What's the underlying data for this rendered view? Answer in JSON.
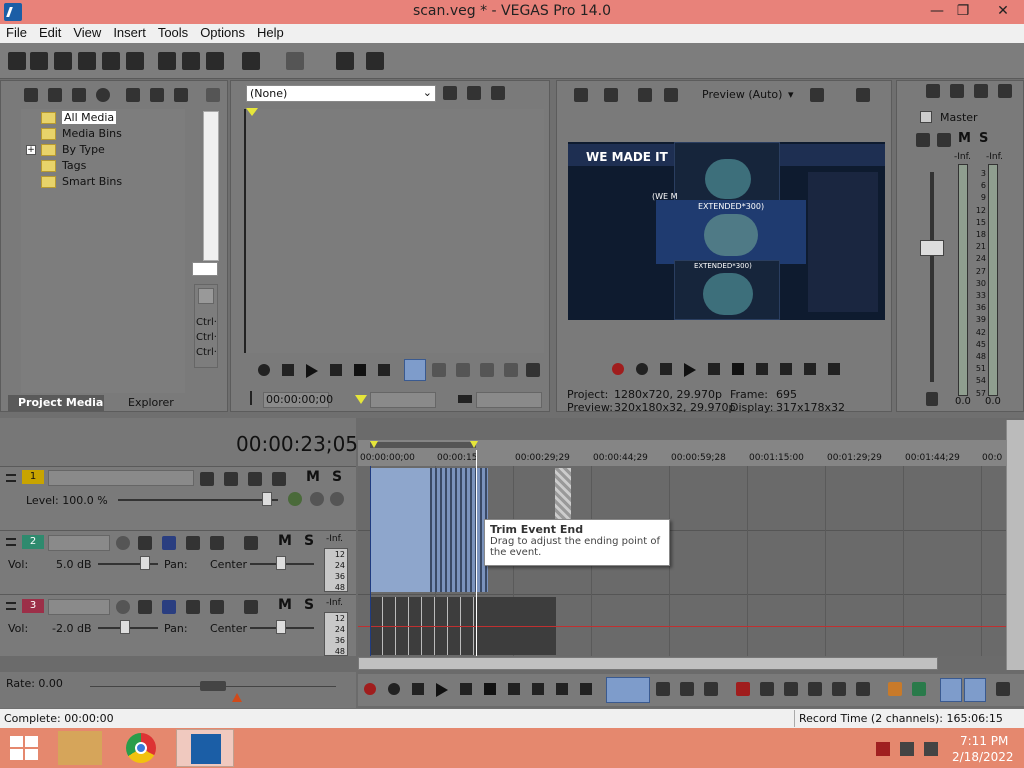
{
  "window": {
    "title": "scan.veg * - VEGAS Pro 14.0",
    "minimize": "—",
    "restore": "❐",
    "close": "✕"
  },
  "menu": [
    "File",
    "Edit",
    "View",
    "Insert",
    "Tools",
    "Options",
    "Help"
  ],
  "project_media": {
    "tree": [
      "All Media",
      "Media Bins",
      "By Type",
      "Tags",
      "Smart Bins"
    ],
    "expander": "+",
    "tabs": [
      "Project Media",
      "Explorer"
    ],
    "side_buttons": [
      "Ctrl·",
      "Ctrl·",
      "Ctrl·"
    ]
  },
  "trimmer": {
    "dropdown_value": "(None)",
    "timecode": "00:00:00;00"
  },
  "preview": {
    "mode": "Preview (Auto)",
    "image_texts": [
      "WE MADE IT",
      "EXTENDED*300)",
      "EXTENDED*300)",
      "(WE M"
    ],
    "project_label": "Project:",
    "project_value": "1280x720, 29.970p",
    "preview_label": "Preview:",
    "preview_value": "320x180x32, 29.970p",
    "frame_label": "Frame:",
    "frame_value": "695",
    "display_label": "Display:",
    "display_value": "317x178x32"
  },
  "master": {
    "label": "Master",
    "m": "M",
    "s": "S",
    "left_inf": "-Inf.",
    "right_inf": "-Inf.",
    "scale": [
      "3",
      "6",
      "9",
      "12",
      "15",
      "18",
      "21",
      "24",
      "27",
      "30",
      "33",
      "36",
      "39",
      "42",
      "45",
      "48",
      "51",
      "54",
      "57"
    ],
    "left_val": "0.0",
    "right_val": "0.0"
  },
  "timeline": {
    "timecode": "00:00:23;05",
    "ruler": [
      "00:00:00;00",
      "00:00:15",
      "00:00:29;29",
      "00:00:44;29",
      "00:00:59;28",
      "00:01:15:00",
      "00:01:29;29",
      "00:01:44;29",
      "00:0"
    ],
    "tracks": [
      {
        "num": "1",
        "label_left": "Level: 100.0 %",
        "m": "M",
        "s": "S"
      },
      {
        "num": "2",
        "label_left": "Vol:",
        "vol": "5.0 dB",
        "pan_label": "Pan:",
        "pan": "Center",
        "m": "M",
        "s": "S",
        "meter": [
          "-Inf.",
          "12",
          "24",
          "36",
          "48"
        ]
      },
      {
        "num": "3",
        "label_left": "Vol:",
        "vol": "-2.0 dB",
        "pan_label": "Pan:",
        "pan": "Center",
        "m": "M",
        "s": "S",
        "meter": [
          "-Inf.",
          "12",
          "24",
          "36",
          "48"
        ]
      }
    ],
    "rate": "Rate: 0.00",
    "tooltip_title": "Trim Event End",
    "tooltip_text": "Drag to adjust the ending point of the event."
  },
  "status": {
    "left": "Complete: 00:00:00",
    "right": "Record Time (2 channels): 165:06:15"
  },
  "taskbar": {
    "time": "7:11 PM",
    "date": "2/18/2022"
  },
  "colors": {
    "titlebar": "#e8827a",
    "taskbar": "#e5886e",
    "track1": "#c8a400",
    "track2": "#2f8a6e",
    "track3": "#9c2f48",
    "video_event": "#8ea6cc"
  }
}
